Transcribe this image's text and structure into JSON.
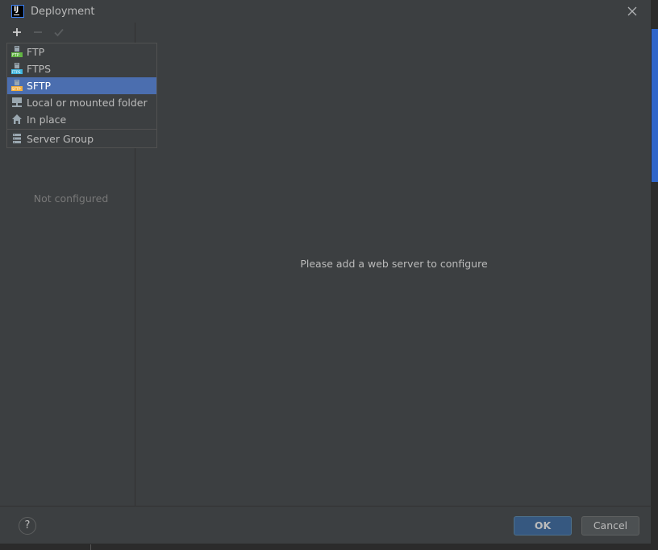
{
  "window": {
    "title": "Deployment",
    "app_icon_letters": "IJ"
  },
  "toolbar": {
    "add": "add-icon",
    "remove": "remove-icon",
    "check": "check-icon"
  },
  "left_panel": {
    "empty_text": "Not configured"
  },
  "right_panel": {
    "message": "Please add a web server to configure"
  },
  "add_menu": {
    "items": [
      {
        "label": "FTP",
        "icon": "ftp-icon"
      },
      {
        "label": "FTPS",
        "icon": "ftps-icon"
      },
      {
        "label": "SFTP",
        "icon": "sftp-icon",
        "selected": true
      },
      {
        "label": "Local or mounted folder",
        "icon": "folder-drive-icon"
      },
      {
        "label": "In place",
        "icon": "home-icon"
      },
      {
        "label": "Server Group",
        "icon": "server-group-icon"
      }
    ]
  },
  "footer": {
    "help": "?",
    "ok": "OK",
    "cancel": "Cancel"
  },
  "colors": {
    "dialog_bg": "#3c3f41",
    "selection": "#4b6eaf",
    "ok_button": "#365880",
    "ide_accent": "#2f65ca"
  }
}
